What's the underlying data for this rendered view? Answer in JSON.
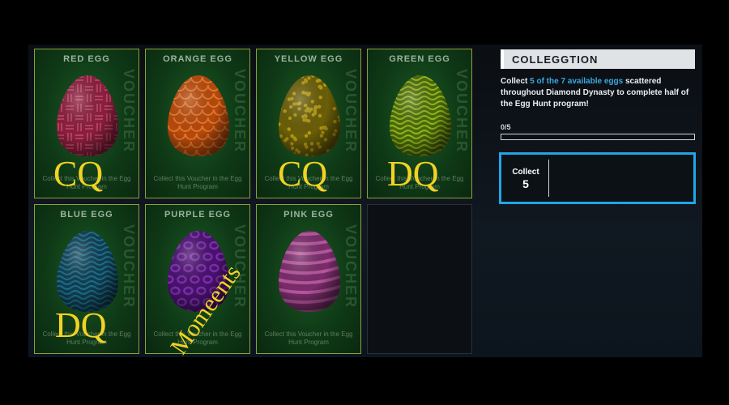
{
  "cards": [
    {
      "title": "RED EGG",
      "description": "Collect this Voucher in the Egg Hunt Program",
      "egg_color": "#8a1f3e",
      "pattern_color": "#b8415f",
      "pattern": "weave"
    },
    {
      "title": "ORANGE EGG",
      "description": "Collect this Voucher in the Egg Hunt Program",
      "egg_color": "#b8480c",
      "pattern_color": "#e0792a",
      "pattern": "scales"
    },
    {
      "title": "YELLOW EGG",
      "description": "Collect this Voucher in the Egg Hunt Program",
      "egg_color": "#6b5e08",
      "pattern_color": "#b59a14",
      "pattern": "speckle"
    },
    {
      "title": "GREEN EGG",
      "description": "Collect this Voucher in the Egg Hunt Program",
      "egg_color": "#4a6a0a",
      "pattern_color": "#93b61c",
      "pattern": "waves"
    },
    {
      "title": "BLUE EGG",
      "description": "Collect this Voucher in the Egg Hunt Program",
      "egg_color": "#0f3e52",
      "pattern_color": "#1f6d88",
      "pattern": "waves"
    },
    {
      "title": "PURPLE EGG",
      "description": "Collect this Voucher in the Egg Hunt Program",
      "egg_color": "#4a1170",
      "pattern_color": "#7b2ea8",
      "pattern": "leopard"
    },
    {
      "title": "PINK EGG",
      "description": "Collect this Voucher in the Egg Hunt Program",
      "egg_color": "#7a2c6a",
      "pattern_color": "#b6579e",
      "pattern": "stripes"
    }
  ],
  "card_watermark": "VOUCHER",
  "overlays": {
    "red": "CQ",
    "yellow": "CQ",
    "green": "DQ",
    "blue": "DQ",
    "purple": "Momeents"
  },
  "collection": {
    "header": "COLLEGGTION",
    "desc_prefix": "Collect ",
    "desc_highlight": "5 of the 7 available eggs",
    "desc_suffix": " scattered throughout Diamond Dynasty to complete half of the Egg Hunt program!",
    "progress_label": "0/5",
    "progress_fraction": 0,
    "collect_label": "Collect",
    "collect_count": "5"
  },
  "colors": {
    "accent": "#20a6e6",
    "card_border": "#8aa23a",
    "overlay_text": "#f2d223"
  }
}
